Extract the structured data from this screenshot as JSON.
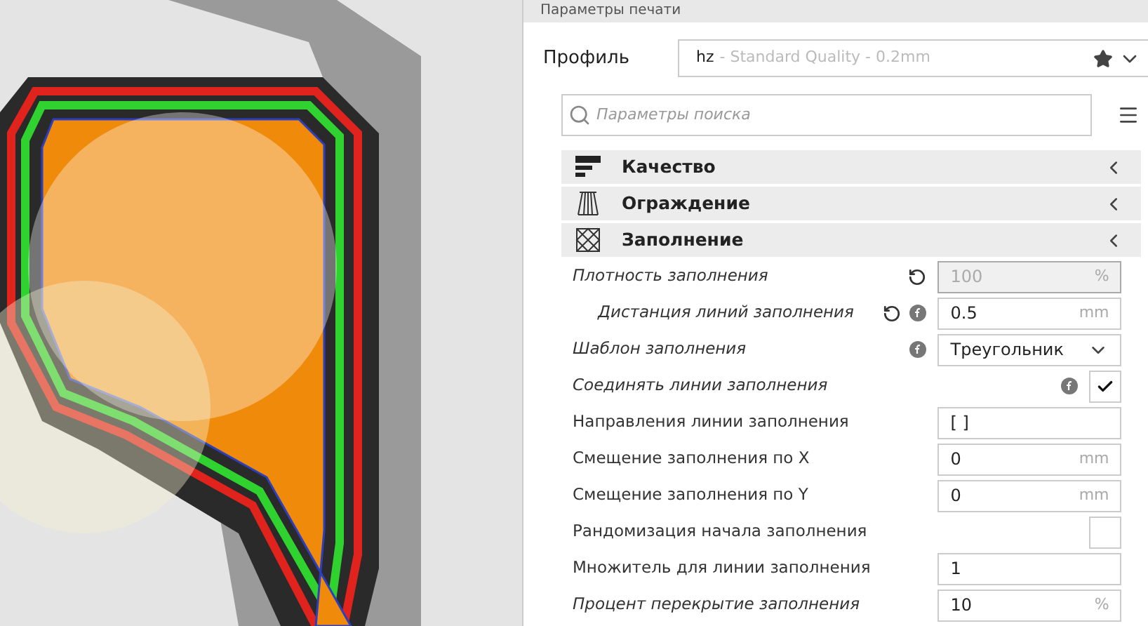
{
  "panel": {
    "title": "Параметры печати",
    "profile_label": "Профиль",
    "profile_name": "hz",
    "profile_detail": "- Standard Quality - 0.2mm",
    "search": {
      "placeholder": "Параметры поиска"
    }
  },
  "sections": [
    {
      "title": "Качество",
      "kind": "quality"
    },
    {
      "title": "Ограждение",
      "kind": "walls"
    },
    {
      "title": "Заполнение",
      "kind": "infill"
    }
  ],
  "settings": [
    {
      "label": "Плотность заполнения",
      "kind": "field",
      "value": "100",
      "unit": "%",
      "overridden": true,
      "resettable": true,
      "inherited": false,
      "disabled": true,
      "children": [
        {
          "label": "Дистанция линий заполнения",
          "kind": "field",
          "value": "0.5",
          "unit": "mm",
          "overridden": true,
          "resettable": true,
          "inherited": true,
          "disabled": false
        }
      ]
    },
    {
      "label": "Шаблон заполнения",
      "kind": "select",
      "value": "Треугольник",
      "overridden": true,
      "resettable": false,
      "inherited": true
    },
    {
      "label": "Соединять линии заполнения",
      "kind": "checkbox",
      "checked": true,
      "overridden": true,
      "resettable": false,
      "inherited": true
    },
    {
      "label": "Направления линии заполнения",
      "kind": "field",
      "value": "[ ]",
      "overridden": false,
      "resettable": false,
      "inherited": false,
      "disabled": false
    },
    {
      "label": "Смещение заполнения по X",
      "kind": "field",
      "value": "0",
      "unit": "mm",
      "overridden": false,
      "resettable": false,
      "inherited": false,
      "disabled": false
    },
    {
      "label": "Смещение заполнения по Y",
      "kind": "field",
      "value": "0",
      "unit": "mm",
      "overridden": false,
      "resettable": false,
      "inherited": false,
      "disabled": false
    },
    {
      "label": "Рандомизация начала заполнения",
      "kind": "checkbox",
      "checked": false,
      "overridden": false,
      "resettable": false,
      "inherited": false
    },
    {
      "label": "Множитель для линии заполнения",
      "kind": "field",
      "value": "1",
      "overridden": false,
      "resettable": false,
      "inherited": false,
      "disabled": false
    },
    {
      "label": "Процент перекрытие заполнения",
      "kind": "field",
      "value": "10",
      "unit": "%",
      "overridden": true,
      "resettable": false,
      "inherited": false,
      "disabled": false
    }
  ]
}
